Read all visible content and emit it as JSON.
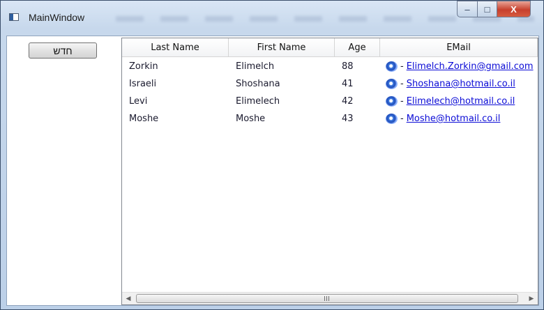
{
  "window": {
    "title": "MainWindow",
    "caption_buttons": {
      "minimize": "–",
      "maximize": "□",
      "close": "X"
    }
  },
  "toolbar": {
    "new_button_label": "חדש"
  },
  "grid": {
    "columns": [
      "Last Name",
      "First Name",
      "Age",
      "EMail"
    ],
    "rows": [
      {
        "last_name": "Zorkin",
        "first_name": "Elimelch",
        "age": "88",
        "email": "Elimelch.Zorkin@gmail.com"
      },
      {
        "last_name": "Israeli",
        "first_name": "Shoshana",
        "age": "41",
        "email": "Shoshana@hotmail.co.il"
      },
      {
        "last_name": "Levi",
        "first_name": "Elimelech",
        "age": "42",
        "email": "Elimelech@hotmail.co.il"
      },
      {
        "last_name": "Moshe",
        "first_name": "Moshe",
        "age": "43",
        "email": "Moshe@hotmail.co.il"
      }
    ],
    "email_separator": "-",
    "email_icon": "ie-globe-icon",
    "scrollbar": {
      "left_arrow": "◀",
      "right_arrow": "▶"
    }
  },
  "colors": {
    "link": "#0b0bd6",
    "close_button": "#c7402d"
  }
}
